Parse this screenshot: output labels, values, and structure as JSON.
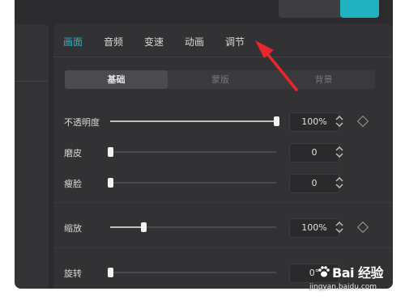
{
  "tabs": [
    {
      "label": "画面",
      "active": true
    },
    {
      "label": "音频",
      "active": false
    },
    {
      "label": "变速",
      "active": false
    },
    {
      "label": "动画",
      "active": false
    },
    {
      "label": "调节",
      "active": false
    }
  ],
  "subtabs": [
    {
      "label": "基础",
      "active": true
    },
    {
      "label": "蒙版",
      "active": false
    },
    {
      "label": "背景",
      "active": false
    }
  ],
  "controls": {
    "opacity": {
      "label": "不透明度",
      "value": "100%",
      "level": 1.0
    },
    "smooth": {
      "label": "磨皮",
      "value": "0",
      "level": 0.0
    },
    "slim": {
      "label": "瘦脸",
      "value": "0",
      "level": 0.0
    },
    "scale": {
      "label": "缩放",
      "value": "100%",
      "level": 0.2
    },
    "rotate": {
      "label": "旋转",
      "value": "0°",
      "level": 0.0
    }
  },
  "watermark": {
    "text": "Bai 经验",
    "url": "jingyan.baidu.com"
  },
  "colors": {
    "accent": "#23b7c5",
    "panel": "#323235",
    "arrow": "#e8262c"
  }
}
